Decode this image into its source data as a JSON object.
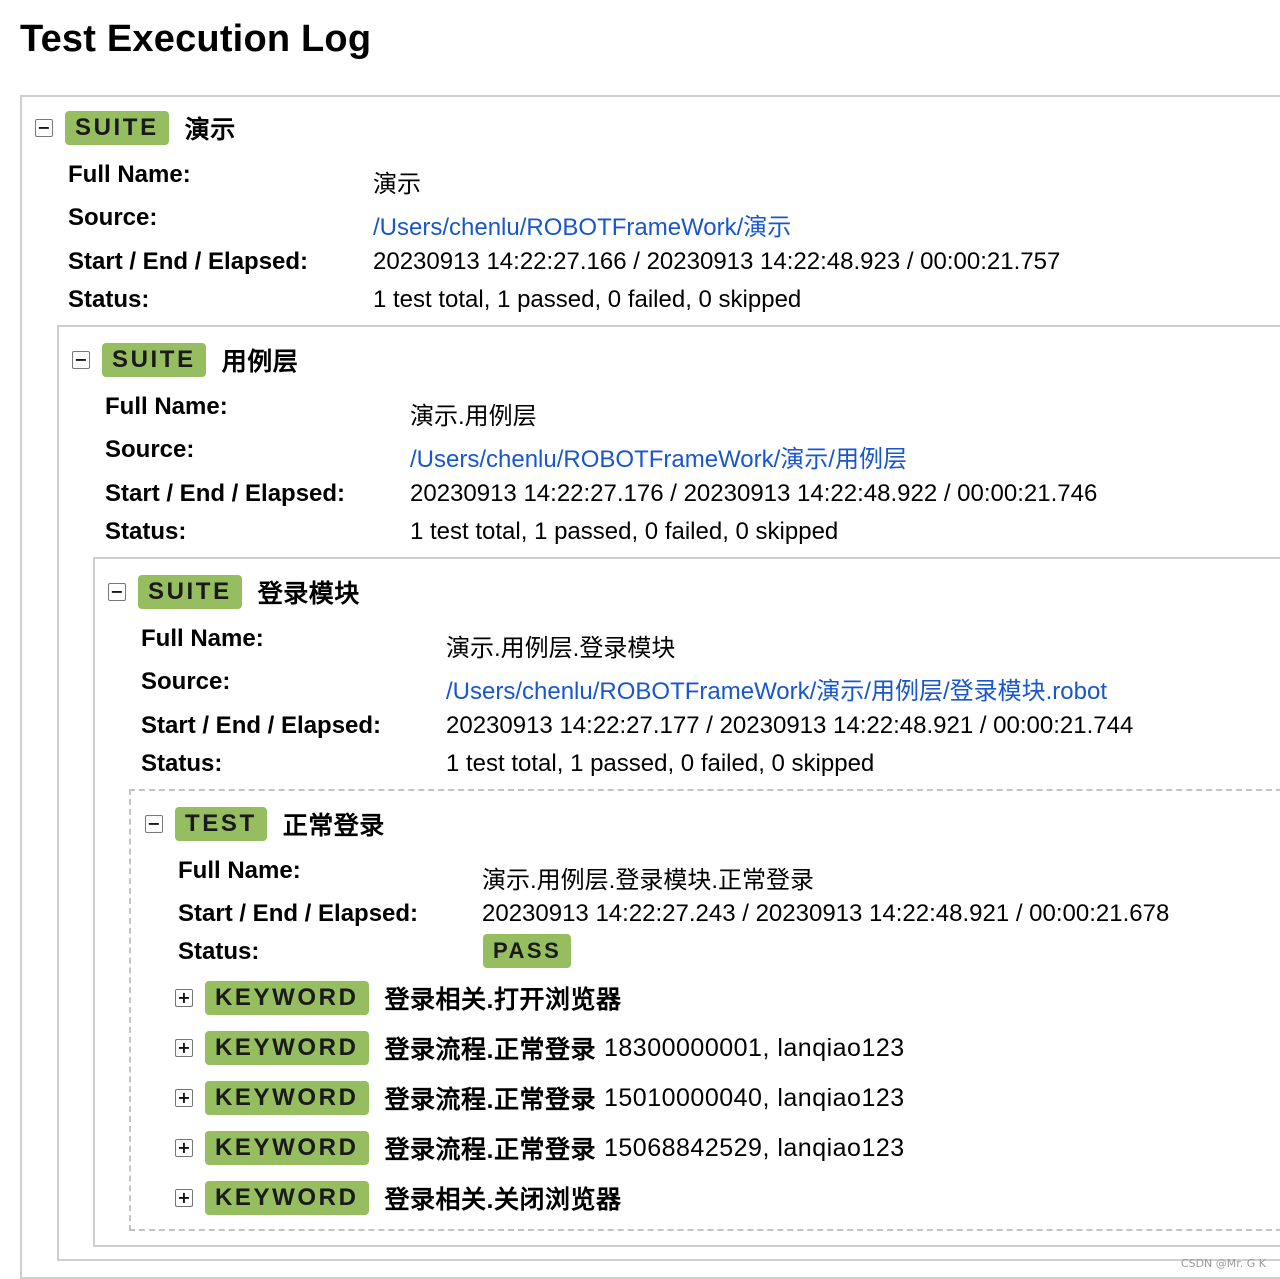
{
  "page_title": "Test Execution Log",
  "labels": {
    "full_name": "Full Name:",
    "source": "Source:",
    "start_end": "Start / End / Elapsed:",
    "status": "Status:"
  },
  "suite1": {
    "toggle": "−",
    "type": "SUITE",
    "name": "演示",
    "full_name": "演示",
    "source": "/Users/chenlu/ROBOTFrameWork/演示",
    "times": "20230913 14:22:27.166 / 20230913 14:22:48.923 / 00:00:21.757",
    "status": "1 test total, 1 passed, 0 failed, 0 skipped"
  },
  "suite2": {
    "toggle": "−",
    "type": "SUITE",
    "name": "用例层",
    "full_name": "演示.用例层",
    "source": "/Users/chenlu/ROBOTFrameWork/演示/用例层",
    "times": "20230913 14:22:27.176 / 20230913 14:22:48.922 / 00:00:21.746",
    "status": "1 test total, 1 passed, 0 failed, 0 skipped"
  },
  "suite3": {
    "toggle": "−",
    "type": "SUITE",
    "name": "登录模块",
    "full_name": "演示.用例层.登录模块",
    "source": "/Users/chenlu/ROBOTFrameWork/演示/用例层/登录模块.robot",
    "times": "20230913 14:22:27.177 / 20230913 14:22:48.921 / 00:00:21.744",
    "status": "1 test total, 1 passed, 0 failed, 0 skipped"
  },
  "test": {
    "toggle": "−",
    "type": "TEST",
    "name": "正常登录",
    "full_name": "演示.用例层.登录模块.正常登录",
    "times": "20230913 14:22:27.243 / 20230913 14:22:48.921 / 00:00:21.678",
    "status": "PASS"
  },
  "keywords": [
    {
      "toggle": "+",
      "type": "KEYWORD",
      "name": "登录相关.打开浏览器",
      "args": ""
    },
    {
      "toggle": "+",
      "type": "KEYWORD",
      "name": "登录流程.正常登录",
      "args": "18300000001, lanqiao123"
    },
    {
      "toggle": "+",
      "type": "KEYWORD",
      "name": "登录流程.正常登录",
      "args": "15010000040, lanqiao123"
    },
    {
      "toggle": "+",
      "type": "KEYWORD",
      "name": "登录流程.正常登录",
      "args": "15068842529, lanqiao123"
    },
    {
      "toggle": "+",
      "type": "KEYWORD",
      "name": "登录相关.关闭浏览器",
      "args": ""
    }
  ],
  "watermark": "CSDN @Mr. G K",
  "colors": {
    "tag_green": "#97bd61",
    "link_blue": "#1856d0",
    "border": "#cfcfcf"
  }
}
